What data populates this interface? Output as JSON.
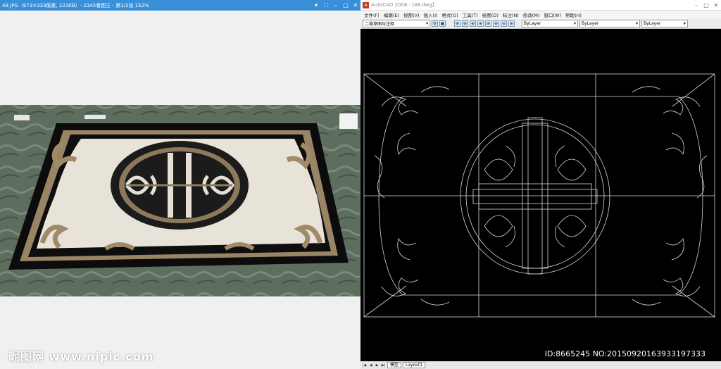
{
  "viewer": {
    "title": "48.JPG（673×333像素, 223KB）- 2345看图王 - 第1/2张 152%",
    "controls": {
      "dropdown": "▾",
      "fit": "⛶",
      "minimize": "–",
      "maximize": "□",
      "close": "✕"
    }
  },
  "cad": {
    "app_icon": "A",
    "title": "AutoCAD 2008 - [48.dwg]",
    "controls": {
      "minimize": "–",
      "maximize": "□",
      "close": "✕"
    },
    "menu": [
      "文件(F)",
      "编辑(E)",
      "视图(V)",
      "插入(I)",
      "格式(O)",
      "工具(T)",
      "绘图(D)",
      "标注(N)",
      "修改(M)",
      "窗口(W)",
      "帮助(H)"
    ],
    "workspace": "二维草图与注释",
    "layer": "ByLayer",
    "linetype": "ByLayer",
    "lineweight": "ByLayer",
    "tabs": {
      "model": "模型",
      "layout1": "Layout1"
    }
  },
  "watermark": {
    "brand": "昵图网 www.nipic.com",
    "id": "ID:8665245 NO:20150920163933197333"
  }
}
